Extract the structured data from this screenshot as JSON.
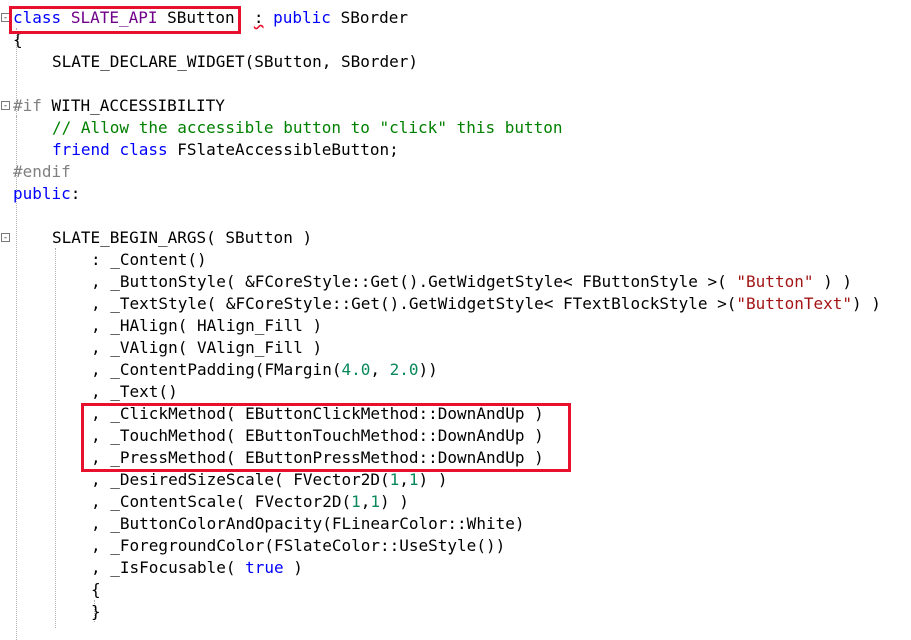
{
  "code": {
    "l0": {
      "kw": "class",
      "macro": "SLATE_API",
      "name": "SButton",
      "colon": ":",
      "access": "public",
      "base": "SBorder"
    },
    "l1": {
      "brace": "{"
    },
    "l2": {
      "text": "SLATE_DECLARE_WIDGET(SButton, SBorder)"
    },
    "l3": {
      "directive": "#if",
      "cond": "WITH_ACCESSIBILITY"
    },
    "l4": {
      "comment": "// Allow the accessible button to \"click\" this button"
    },
    "l5": {
      "kw1": "friend",
      "kw2": "class",
      "name": "FSlateAccessibleButton;"
    },
    "l6": {
      "directive": "#endif"
    },
    "l7": {
      "kw": "public",
      "colon": ":"
    },
    "l8": {
      "text": "SLATE_BEGIN_ARGS( SButton )"
    },
    "l9": {
      "text": ": _Content()"
    },
    "l10": {
      "pre": ", _ButtonStyle( &FCoreStyle::Get().GetWidgetStyle< FButtonStyle >( ",
      "str": "\"Button\"",
      "post": " ) )"
    },
    "l11": {
      "pre": ", _TextStyle( &FCoreStyle::Get().GetWidgetStyle< FTextBlockStyle >(",
      "str": "\"ButtonText\"",
      "post": ") )"
    },
    "l12": {
      "text": ", _HAlign( HAlign_Fill )"
    },
    "l13": {
      "text": ", _VAlign( VAlign_Fill )"
    },
    "l14": {
      "pre": ", _ContentPadding(FMargin(",
      "n1": "4.0",
      "sep": ", ",
      "n2": "2.0",
      "post": "))"
    },
    "l15": {
      "text": ", _Text()"
    },
    "l16": {
      "text": ", _ClickMethod( EButtonClickMethod::DownAndUp )"
    },
    "l17": {
      "text": ", _TouchMethod( EButtonTouchMethod::DownAndUp )"
    },
    "l18": {
      "text": ", _PressMethod( EButtonPressMethod::DownAndUp )"
    },
    "l19": {
      "pre": ", _DesiredSizeScale( FVector2D(",
      "n1": "1",
      "sep": ",",
      "n2": "1",
      "post": ") )"
    },
    "l20": {
      "pre": ", _ContentScale( FVector2D(",
      "n1": "1",
      "sep": ",",
      "n2": "1",
      "post": ") )"
    },
    "l21": {
      "text": ", _ButtonColorAndOpacity(FLinearColor::White)"
    },
    "l22": {
      "text": ", _ForegroundColor(FSlateColor::UseStyle())"
    },
    "l23": {
      "pre": ", _IsFocusable( ",
      "kw": "true",
      "post": " )"
    },
    "l24": {
      "brace": "{"
    },
    "l25": {
      "brace": "}"
    }
  },
  "colors": {
    "keyword": "#0000ff",
    "type": "#2b91af",
    "macro": "#6f008a",
    "comment": "#008000",
    "string": "#a31515",
    "number": "#09885a",
    "highlight": "#e8112d"
  },
  "fold_icon_open": "-"
}
